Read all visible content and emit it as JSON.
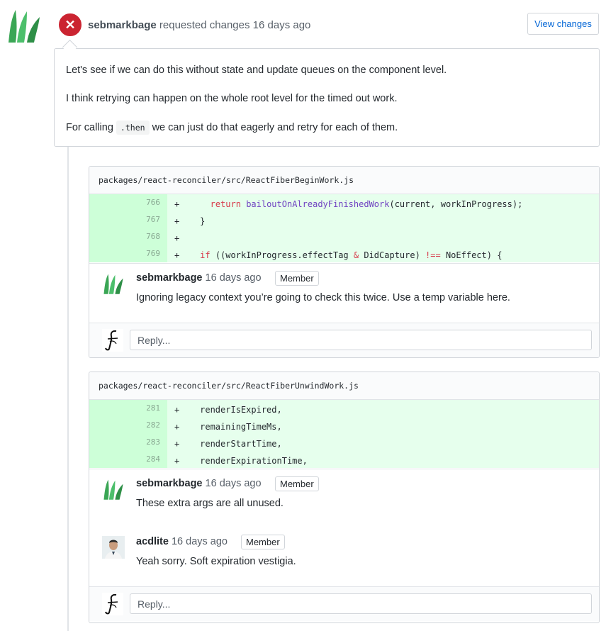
{
  "review": {
    "author": "sebmarkbage",
    "action": "requested changes 16 days ago",
    "view_changes_label": "View changes",
    "paragraphs": [
      "Let's see if we can do this without state and update queues on the component level.",
      "I think retrying can happen on the whole root level for the timed out work."
    ],
    "p3_before": "For calling",
    "p3_code": ".then",
    "p3_after": "we can just do that eagerly and retry for each of them."
  },
  "files": [
    {
      "path": "packages/react-reconciler/src/ReactFiberBeginWork.js",
      "lines": [
        {
          "num": "766",
          "sign": "+"
        },
        {
          "num": "767",
          "sign": "+",
          "code": "    }"
        },
        {
          "num": "768",
          "sign": "+",
          "code": ""
        },
        {
          "num": "769",
          "sign": "+"
        }
      ],
      "line1": {
        "indent": "      ",
        "kw": "return",
        "fn": "bailoutOnAlreadyFinishedWork",
        "rest": "(current, workInProgress);"
      },
      "line4": {
        "indent": "    ",
        "kw1": "if",
        "mid1": " ((workInProgress.effectTag ",
        "op1": "&",
        "mid2": " DidCapture) ",
        "op2": "!==",
        "rest": " NoEffect) {"
      },
      "comments": [
        {
          "author": "sebmarkbage",
          "time": "16 days ago",
          "badge": "Member",
          "text": "Ignoring legacy context you’re going to check this twice. Use a temp variable here."
        }
      ],
      "reply_placeholder": "Reply..."
    },
    {
      "path": "packages/react-reconciler/src/ReactFiberUnwindWork.js",
      "lines": [
        {
          "num": "281",
          "sign": "+",
          "code": "    renderIsExpired,"
        },
        {
          "num": "282",
          "sign": "+",
          "code": "    remainingTimeMs,"
        },
        {
          "num": "283",
          "sign": "+",
          "code": "    renderStartTime,"
        },
        {
          "num": "284",
          "sign": "+",
          "code": "    renderExpirationTime,"
        }
      ],
      "comments": [
        {
          "author": "sebmarkbage",
          "time": "16 days ago",
          "badge": "Member",
          "text": "These extra args are all unused."
        },
        {
          "author": "acdlite",
          "time": "16 days ago",
          "badge": "Member",
          "text": "Yeah sorry. Soft expiration vestigia."
        }
      ],
      "reply_placeholder": "Reply..."
    }
  ],
  "colors": {
    "danger": "#cb2431",
    "link": "#0366d6",
    "addition_bg": "#e6ffed",
    "addition_num_bg": "#cdffd8"
  }
}
